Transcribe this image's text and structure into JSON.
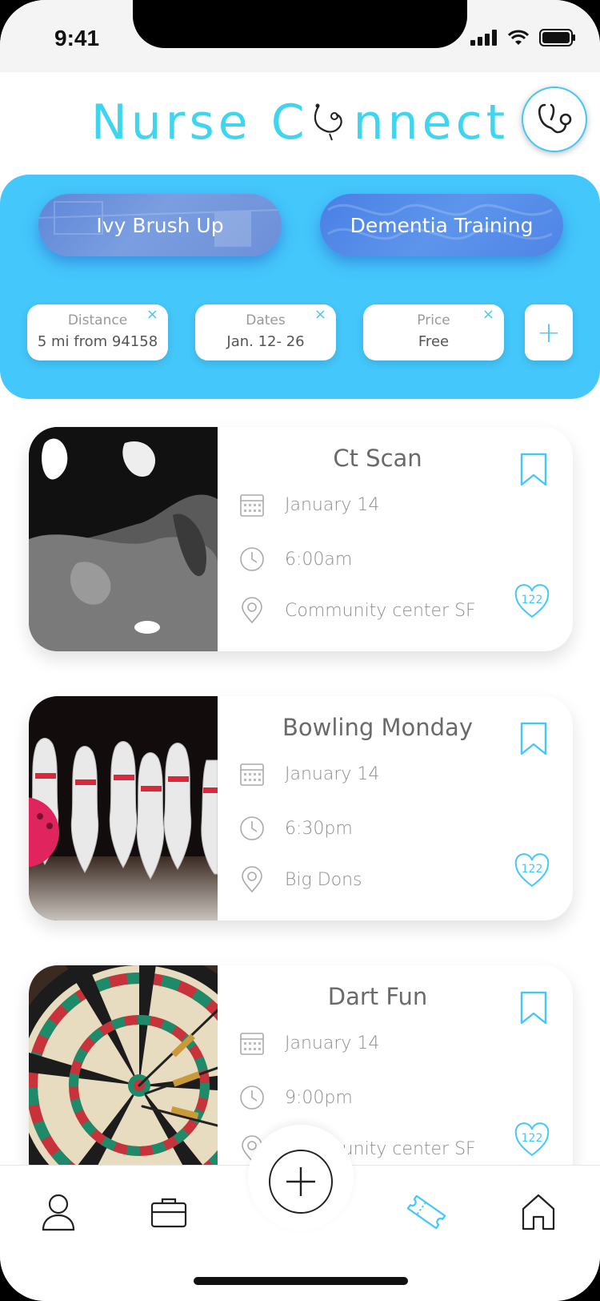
{
  "status": {
    "time": "9:41"
  },
  "app": {
    "title_prefix": "Nurse C",
    "title_suffix": "nnect"
  },
  "topics": [
    {
      "label": "Ivy Brush Up"
    },
    {
      "label": "Dementia Training"
    }
  ],
  "filters": [
    {
      "label": "Distance",
      "value": "5 mi from 94158",
      "close": "×"
    },
    {
      "label": "Dates",
      "value": "Jan. 12- 26",
      "close": "×"
    },
    {
      "label": "Price",
      "value": "Free",
      "close": "×"
    }
  ],
  "add_filter_symbol": "+",
  "events": [
    {
      "title": "Ct  Scan",
      "date": "January 14",
      "time": "6:00am",
      "location": "Community center SF",
      "likes": "122",
      "image": "ct-scan-photo"
    },
    {
      "title": "Bowling Monday",
      "date": "January 14",
      "time": "6:30pm",
      "location": "Big Dons",
      "likes": "122",
      "image": "bowling-pins-photo"
    },
    {
      "title": "Dart Fun",
      "date": "January 14",
      "time": "9:00pm",
      "location": "Community center SF",
      "likes": "122",
      "image": "dartboard-photo"
    }
  ],
  "colors": {
    "accent": "#3ed6ee",
    "panel": "#44c7fb",
    "text": "#6a6a6a",
    "muted": "#8e8e8e"
  },
  "nav": {
    "items": [
      "profile-icon",
      "briefcase-icon",
      "add-icon",
      "ticket-icon",
      "home-icon"
    ]
  }
}
